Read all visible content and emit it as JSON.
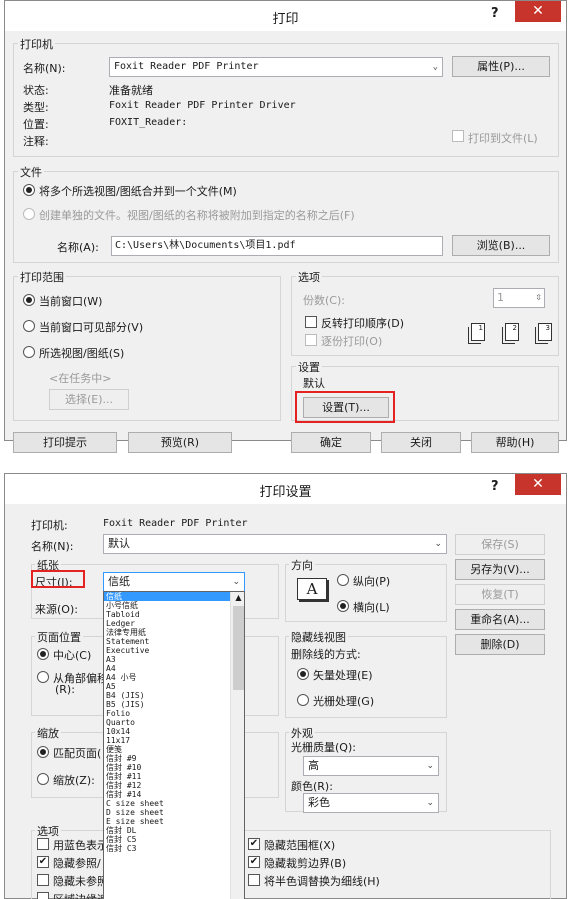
{
  "print": {
    "title": "打印",
    "help": "?",
    "close": "✕",
    "printer_group": "打印机",
    "name_label": "名称(N):",
    "name_value": "Foxit Reader PDF Printer",
    "properties_button": "属性(P)...",
    "status_label": "状态:",
    "status_value": "准备就绪",
    "type_label": "类型:",
    "type_value": "Foxit Reader PDF Printer Driver",
    "where_label": "位置:",
    "where_value": "FOXIT_Reader:",
    "comment_label": "注释:",
    "print_to_file": "打印到文件(L)",
    "file_group": "文件",
    "merge_radio": "将多个所选视图/图纸合并到一个文件(M)",
    "separate_radio": "创建单独的文件。视图/图纸的名称将被附加到指定的名称之后(F)",
    "filename_label": "名称(A):",
    "filename_value": "C:\\Users\\林\\Documents\\项目1.pdf",
    "browse_button": "浏览(B)...",
    "range_group": "打印范围",
    "current_window": "当前窗口(W)",
    "visible_part": "当前窗口可见部分(V)",
    "selected_views": "所选视图/图纸(S)",
    "in_task": "<在任务中>",
    "select_button": "选择(E)...",
    "options_group": "选项",
    "copies_label": "份数(C):",
    "copies_value": "1",
    "reverse_order": "反转打印顺序(D)",
    "collate": "逐份打印(O)",
    "settings_group": "设置",
    "settings_value": "默认",
    "settings_button": "设置(T)...",
    "tips_button": "打印提示",
    "preview_button": "预览(R)",
    "ok_button": "确定",
    "close_button": "关闭",
    "help_button": "帮助(H)"
  },
  "setup": {
    "title": "打印设置",
    "help": "?",
    "close": "✕",
    "printer_label": "打印机:",
    "printer_value": "Foxit Reader PDF Printer",
    "name_label": "名称(N):",
    "name_value": "默认",
    "save_button": "保存(S)",
    "save_as_button": "另存为(V)...",
    "revert_button": "恢复(T)",
    "rename_button": "重命名(A)...",
    "delete_button": "删除(D)",
    "paper_group": "纸张",
    "size_label": "尺寸(I):",
    "size_value": "信纸",
    "source_label": "来源(O):",
    "paper_list": [
      "信纸",
      "小号信纸",
      "Tabloid",
      "Ledger",
      "法律专用纸",
      "Statement",
      "Executive",
      "A3",
      "A4",
      "A4 小号",
      "A5",
      "B4 (JIS)",
      "B5 (JIS)",
      "Folio",
      "Quarto",
      "10x14",
      "11x17",
      "便笺",
      "信封 #9",
      "信封 #10",
      "信封 #11",
      "信封 #12",
      "信封 #14",
      "C size sheet",
      "D size sheet",
      "E size sheet",
      "信封 DL",
      "信封 C5",
      "信封 C3"
    ],
    "orientation_group": "方向",
    "portrait": "纵向(P)",
    "landscape": "横向(L)",
    "orientation_icon": "A",
    "position_group": "页面位置",
    "center": "中心(C)",
    "from_corner": "从角部偏移",
    "from_corner_suffix": "(R):",
    "hidden_lines_group": "隐藏线视图",
    "hidden_lines_label": "删除线的方式:",
    "vector": "矢量处理(E)",
    "raster": "光栅处理(G)",
    "zoom_group": "缩放",
    "fit_to_page": "匹配页面(",
    "zoom": "缩放(Z):",
    "appearance_group": "外观",
    "raster_quality_label": "光栅质量(Q):",
    "raster_quality_value": "高",
    "colors_label": "颜色(R):",
    "colors_value": "彩色",
    "options_group": "选项",
    "opt_blue": "用蓝色表示",
    "opt_hide_ref": "隐藏参照/",
    "opt_hide_unref": "隐藏未参照",
    "opt_region": "区域边缘遮",
    "opt_hide_scope": "隐藏范围框(X)",
    "opt_hide_crop": "隐藏裁剪边界(B)",
    "opt_halftone": "将半色调替换为细线(H)"
  },
  "icons": {
    "dropdown": "chevron-down-icon",
    "spinner": "spin-arrows-icon",
    "collate_pages": "page-stack-icon"
  },
  "colors": {
    "close_red": "#c7342b",
    "highlight_red": "#e52222",
    "list_selection": "#3399ff"
  }
}
